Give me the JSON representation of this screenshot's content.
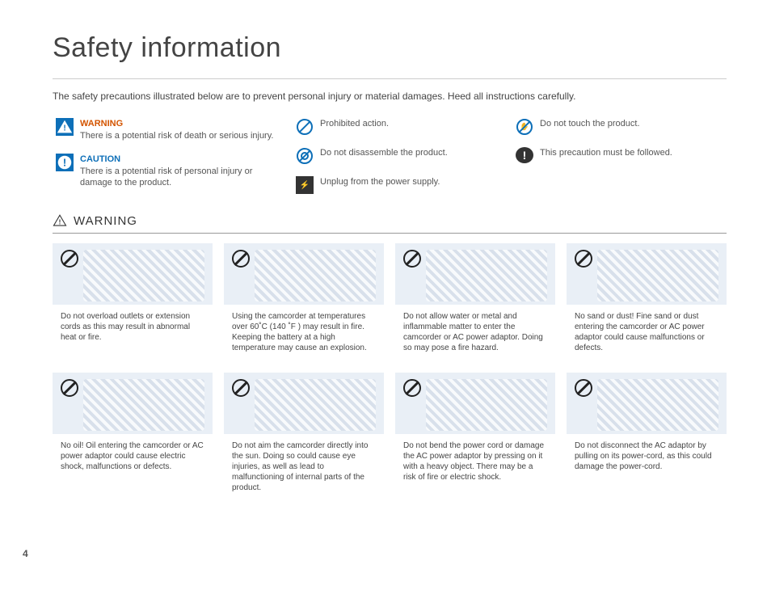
{
  "page_number": "4",
  "title": "Safety information",
  "intro": "The safety precautions illustrated below are to prevent personal injury or material damages. Heed all instructions carefully.",
  "legend": {
    "warning": {
      "heading": "WARNING",
      "body": "There is a potential risk of death or serious injury."
    },
    "caution": {
      "heading": "CAUTION",
      "body": "There is a potential risk of personal injury or damage to the product."
    },
    "prohibited": "Prohibited action.",
    "disassemble": "Do not disassemble the product.",
    "unplug": "Unplug from the power supply.",
    "touch": "Do not touch the product.",
    "follow": "This precaution must be followed."
  },
  "section_heading": "WARNING",
  "cards": [
    {
      "text": "Do not overload outlets or extension cords as this may result in abnormal heat or fire."
    },
    {
      "text": "Using the camcorder at temperatures over 60˚C (140 ˚F ) may result in fire. Keeping the battery at a high temperature may cause an explosion."
    },
    {
      "text": "Do not allow water or metal and inflammable matter to enter the camcorder or AC power adaptor. Doing so may pose a fire hazard."
    },
    {
      "text": "No sand or dust! Fine sand or dust entering the camcorder or AC power adaptor could cause malfunctions or defects."
    },
    {
      "text": "No oil! Oil entering the camcorder or AC power adaptor could cause electric shock, malfunctions or defects."
    },
    {
      "text": "Do not aim the camcorder directly into the sun. Doing so could cause eye injuries, as well as lead to malfunctioning of internal parts of the product."
    },
    {
      "text": "Do not bend the power cord or damage the AC power adaptor by pressing on it with a heavy object. There may be a risk of fire or electric shock."
    },
    {
      "text": "Do not disconnect the AC adaptor by pulling on its power-cord, as this could damage the power-cord."
    }
  ]
}
